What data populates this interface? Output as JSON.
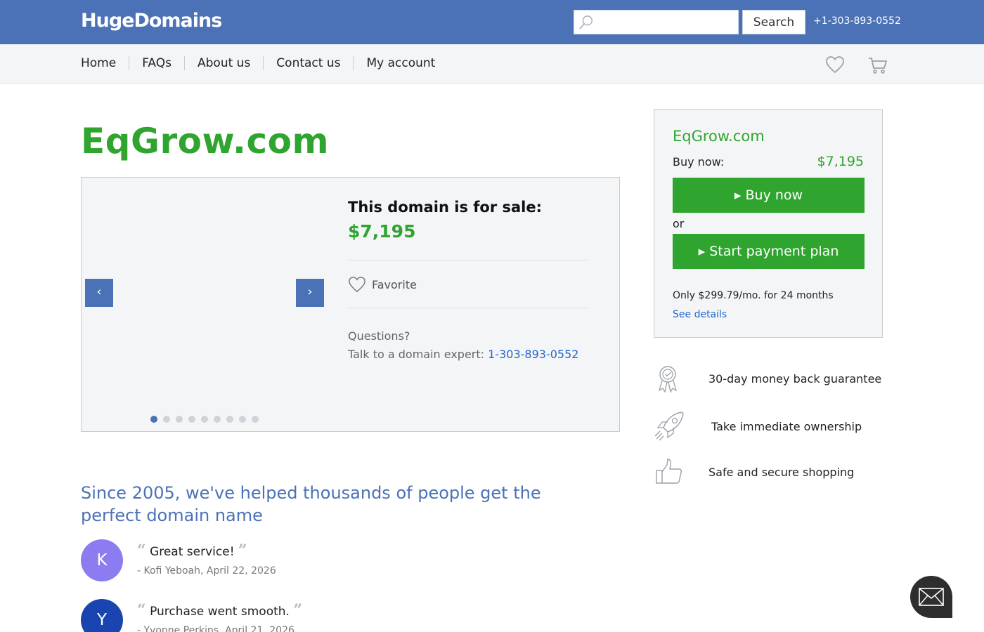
{
  "header": {
    "logo": "HugeDomains",
    "search_placeholder": "",
    "search_button": "Search",
    "phone": "+1-303-893-0552"
  },
  "nav": {
    "items": [
      "Home",
      "FAQs",
      "About us",
      "Contact us",
      "My account"
    ]
  },
  "domain": {
    "name": "EqGrow.com"
  },
  "carousel": {
    "prev": "‹",
    "next": "›",
    "sale_heading": "This domain is for sale:",
    "price": "$7,195",
    "favorite": "Favorite",
    "questions": "Questions?",
    "talk_prefix": "Talk to a domain expert: ",
    "phone": "1-303-893-0552",
    "dots_count": 9,
    "active_dot": 0
  },
  "buybox": {
    "title": "EqGrow.com",
    "buy_label": "Buy now:",
    "buy_price": "$7,195",
    "buy_button": "▸ Buy now",
    "or": "or",
    "plan_button": "▸ Start payment plan",
    "only": "Only $299.79/mo. for 24 months",
    "see_details": "See details"
  },
  "features": [
    {
      "icon": "award-ribbon-icon",
      "text": "30-day money back guarantee"
    },
    {
      "icon": "rocket-icon",
      "text": "Take immediate ownership"
    },
    {
      "icon": "thumbs-up-icon",
      "text": "Safe and secure shopping"
    }
  ],
  "testimonials": {
    "heading": "Since 2005, we've helped thousands of people get the perfect domain name",
    "reviews": [
      {
        "initial": "K",
        "color": "#8b7cf2",
        "text": "Great service!",
        "author": "- Kofi Yeboah, April 22, 2026"
      },
      {
        "initial": "Y",
        "color": "#1a44b0",
        "text": "Purchase went smooth.",
        "author": "- Yvonne Perkins, April 21, 2026"
      }
    ]
  },
  "colors": {
    "brand_blue": "#4b72b6",
    "accent_green": "#2fa52f",
    "link_blue": "#2266cc"
  },
  "chat": {
    "icon": "envelope-icon"
  }
}
